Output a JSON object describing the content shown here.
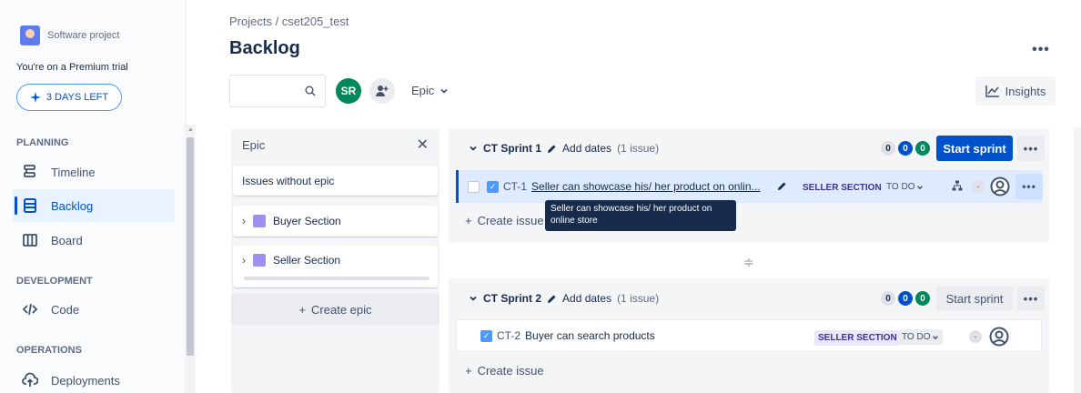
{
  "sidebar": {
    "project_name": "Software project",
    "trial_text": "You're on a Premium trial",
    "days_left": "3 DAYS LEFT",
    "sections": {
      "planning": "PLANNING",
      "development": "DEVELOPMENT",
      "operations": "OPERATIONS"
    },
    "items": {
      "timeline": "Timeline",
      "backlog": "Backlog",
      "board": "Board",
      "code": "Code",
      "deployments": "Deployments"
    }
  },
  "header": {
    "breadcrumb": "Projects / cset205_test",
    "title": "Backlog",
    "avatar_initials": "SR",
    "epic_filter": "Epic",
    "insights": "Insights"
  },
  "epic_panel": {
    "title": "Epic",
    "issues_without_epic": "Issues without epic",
    "epics": [
      "Buyer Section",
      "Seller Section"
    ],
    "create_epic": "Create epic"
  },
  "sprints": [
    {
      "name": "CT Sprint 1",
      "add_dates": "Add dates",
      "issue_count": "(1 issue)",
      "counts": [
        "0",
        "0",
        "0"
      ],
      "start_label": "Start sprint",
      "issue": {
        "key": "CT-1",
        "summary": "Seller can showcase his/ her product on onlin...",
        "epic": "SELLER SECTION",
        "status": "TO DO"
      },
      "create_issue": "Create issue"
    },
    {
      "name": "CT Sprint 2",
      "add_dates": "Add dates",
      "issue_count": "(1 issue)",
      "counts": [
        "0",
        "0",
        "0"
      ],
      "start_label": "Start sprint",
      "issue": {
        "key": "CT-2",
        "summary": "Buyer can search products",
        "epic": "SELLER SECTION",
        "status": "TO DO"
      },
      "create_issue": "Create issue"
    }
  ],
  "tooltip": "Seller can showcase his/ her product on online store",
  "colors": {
    "primary": "#0052cc",
    "success": "#00875a",
    "epic_purple": "#9f8fef",
    "epic_label_text": "#403294"
  }
}
